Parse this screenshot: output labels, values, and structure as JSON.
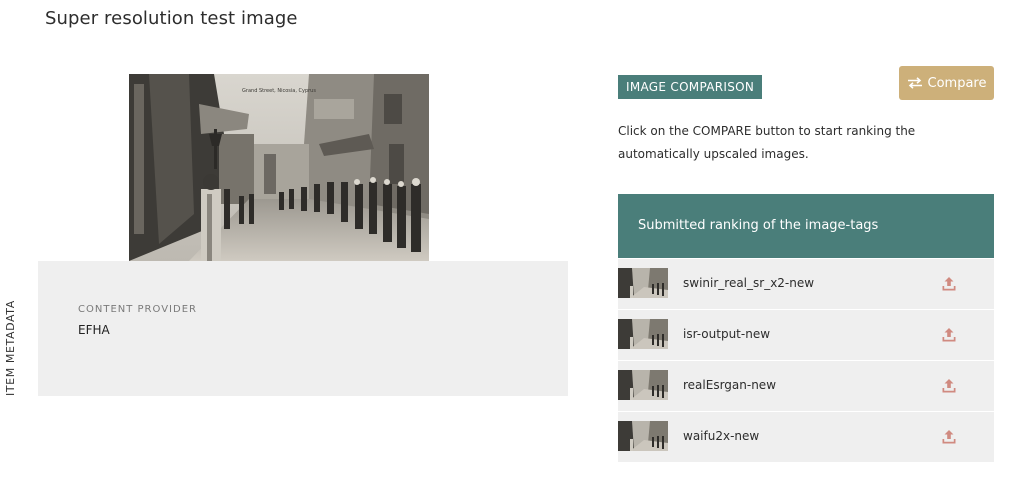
{
  "page": {
    "title": "Super resolution test image"
  },
  "metadata": {
    "side_label": "ITEM METADATA",
    "content_provider_label": "CONTENT PROVIDER",
    "content_provider_value": "EFHA"
  },
  "comparison": {
    "badge": "IMAGE COMPARISON",
    "button_label": "Compare",
    "button_icon": "swap-arrows-icon",
    "description": "Click on the COMPARE button to start ranking the automatically upscaled images."
  },
  "ranking": {
    "header": "Submitted ranking of the image-tags",
    "items": [
      {
        "label": "swinir_real_sr_x2-new",
        "icon": "upload-icon"
      },
      {
        "label": "isr-output-new",
        "icon": "upload-icon"
      },
      {
        "label": "realEsrgan-new",
        "icon": "upload-icon"
      },
      {
        "label": "waifu2x-new",
        "icon": "upload-icon"
      }
    ]
  },
  "photo": {
    "caption": "Grand Street, Nicosia, Cyprus"
  },
  "colors": {
    "teal": "#4a7e7a",
    "gold": "#cdb07a",
    "panel": "#efefef",
    "upload_icon": "#d08a80"
  }
}
